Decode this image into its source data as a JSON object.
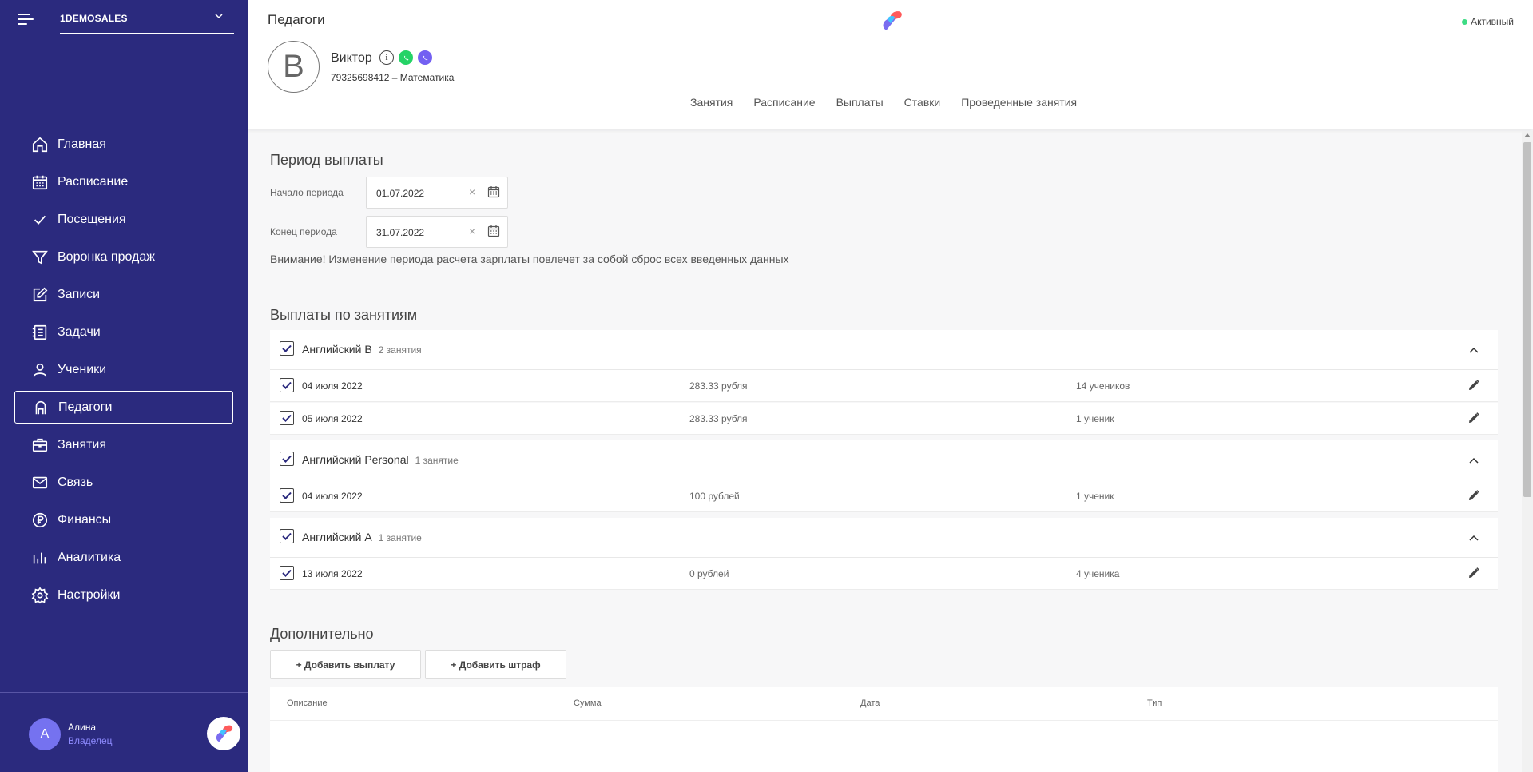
{
  "sidebar": {
    "org_name": "1DEMOSALES",
    "items": [
      {
        "label": "Главная"
      },
      {
        "label": "Расписание"
      },
      {
        "label": "Посещения"
      },
      {
        "label": "Воронка продаж"
      },
      {
        "label": "Записи"
      },
      {
        "label": "Задачи"
      },
      {
        "label": "Ученики"
      },
      {
        "label": "Педагоги",
        "active": true
      },
      {
        "label": "Занятия"
      },
      {
        "label": "Связь"
      },
      {
        "label": "Финансы"
      },
      {
        "label": "Аналитика"
      },
      {
        "label": "Настройки"
      }
    ],
    "user": {
      "initial": "А",
      "name": "Алина",
      "role": "Владелец"
    }
  },
  "header": {
    "title": "Педагоги",
    "status": "Активный",
    "teacher": {
      "initial": "В",
      "name": "Виктор",
      "subtitle": "79325698412 – Математика"
    },
    "tabs": [
      "Занятия",
      "Расписание",
      "Выплаты",
      "Ставки",
      "Проведенные занятия"
    ]
  },
  "period": {
    "title": "Период выплаты",
    "start_label": "Начало периода",
    "start_value": "01.07.2022",
    "end_label": "Конец периода",
    "end_value": "31.07.2022",
    "warning": "Внимание! Изменение периода расчета зарплаты повлечет за собой сброс всех введенных данных"
  },
  "payments": {
    "title": "Выплаты по занятиям",
    "groups": [
      {
        "name": "Английский B",
        "count": "2 занятия",
        "rows": [
          {
            "date": "04 июля 2022",
            "sum": "283.33 рубля",
            "students": "14 учеников"
          },
          {
            "date": "05 июля 2022",
            "sum": "283.33 рубля",
            "students": "1 ученик"
          }
        ]
      },
      {
        "name": "Английский Personal",
        "count": "1 занятие",
        "rows": [
          {
            "date": "04 июля 2022",
            "sum": "100 рублей",
            "students": "1 ученик"
          }
        ]
      },
      {
        "name": "Английский A",
        "count": "1 занятие",
        "rows": [
          {
            "date": "13 июля 2022",
            "sum": "0 рублей",
            "students": "4 ученика"
          }
        ]
      }
    ]
  },
  "extra": {
    "title": "Дополнительно",
    "add_payment": "+ Добавить выплату",
    "add_fine": "+ Добавить штраф",
    "columns": [
      "Описание",
      "Сумма",
      "Дата",
      "Тип"
    ]
  },
  "colors": {
    "sidebar_bg": "#2b2a7e",
    "accent": "#7572f0",
    "status_green": "#3ddc84",
    "whatsapp": "#25d366",
    "viber": "#7360f2"
  },
  "icons": {
    "nav": [
      "home-icon",
      "calendar-icon",
      "check-icon",
      "funnel-icon",
      "edit-note-icon",
      "tasks-list-icon",
      "user-icon",
      "teacher-icon",
      "briefcase-icon",
      "mail-icon",
      "ruble-icon",
      "chart-icon",
      "settings-gear-icon"
    ]
  }
}
